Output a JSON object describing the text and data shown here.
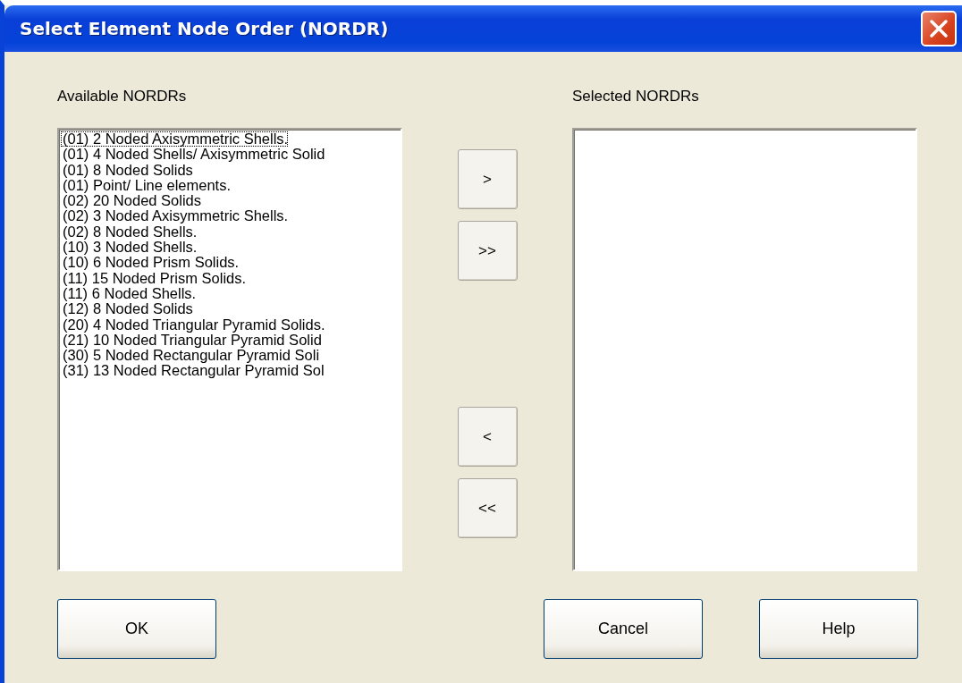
{
  "window": {
    "title": "Select Element Node Order (NORDR)"
  },
  "available": {
    "label": "Available NORDRs",
    "items": [
      {
        "text": "(01) 2 Noded Axisymmetric Shells.",
        "selected": false,
        "focused": true
      },
      {
        "text": "(01) 4 Noded Shells/ Axisymmetric Solid",
        "selected": false,
        "focused": false
      },
      {
        "text": "(01) 8 Noded Solids",
        "selected": false,
        "focused": false
      },
      {
        "text": "(01) Point/ Line elements.",
        "selected": false,
        "focused": false
      },
      {
        "text": "(02) 20 Noded Solids",
        "selected": false,
        "focused": false
      },
      {
        "text": "(02) 3 Noded Axisymmetric Shells.",
        "selected": false,
        "focused": false
      },
      {
        "text": "(02) 8 Noded Shells.",
        "selected": false,
        "focused": false
      },
      {
        "text": "(10) 3 Noded Shells.",
        "selected": false,
        "focused": false
      },
      {
        "text": "(10) 6 Noded Prism Solids.",
        "selected": false,
        "focused": false
      },
      {
        "text": "(11) 15 Noded Prism Solids.",
        "selected": false,
        "focused": false
      },
      {
        "text": "(11) 6 Noded Shells.",
        "selected": false,
        "focused": false
      },
      {
        "text": "(12) 8 Noded Solids",
        "selected": false,
        "focused": false
      },
      {
        "text": "(20) 4 Noded Triangular Pyramid Solids.",
        "selected": false,
        "focused": false
      },
      {
        "text": "(21) 10 Noded Triangular Pyramid Solid",
        "selected": false,
        "focused": false
      },
      {
        "text": "(30) 5 Noded Rectangular Pyramid Soli",
        "selected": false,
        "focused": false
      },
      {
        "text": "(31) 13 Noded Rectangular Pyramid Sol",
        "selected": false,
        "focused": false
      }
    ]
  },
  "move_buttons": [
    ">",
    ">>",
    "<",
    "<<"
  ],
  "selected_list": {
    "label": "Selected NORDRs"
  },
  "buttons": [
    "OK",
    "Cancel",
    "Help"
  ]
}
